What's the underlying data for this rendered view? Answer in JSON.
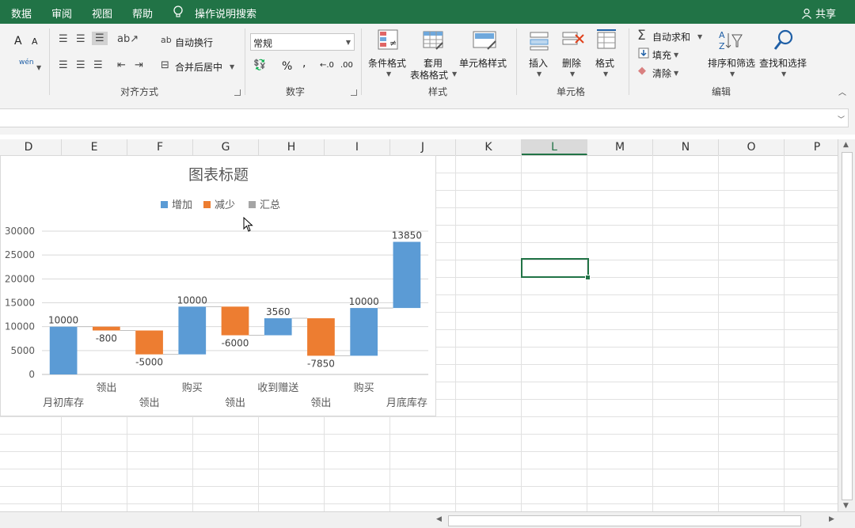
{
  "tabs": [
    "数据",
    "审阅",
    "视图",
    "帮助"
  ],
  "tell_me": "操作说明搜索",
  "share": "共享",
  "ribbon": {
    "font_grow": "A",
    "font_shrink": "A",
    "phonetic": "wén",
    "wrap_text": "自动换行",
    "merge_center": "合并后居中",
    "number_format": "常规",
    "percent": "%",
    "comma": ",",
    "inc_decimal": "←.0",
    "dec_decimal": ".00",
    "cond_format": "条件格式",
    "table_format_1": "套用",
    "table_format_2": "表格格式",
    "cell_styles": "单元格样式",
    "insert": "插入",
    "delete": "删除",
    "format": "格式",
    "autosum": "自动求和",
    "fill": "填充",
    "clear": "清除",
    "sort_filter": "排序和筛选",
    "find_select": "查找和选择",
    "groups": {
      "alignment": "对齐方式",
      "number": "数字",
      "styles": "样式",
      "cells": "单元格",
      "editing": "编辑"
    }
  },
  "columns": [
    "D",
    "E",
    "F",
    "G",
    "H",
    "I",
    "J",
    "K",
    "L",
    "M",
    "N",
    "O",
    "P"
  ],
  "selected_column": "L",
  "chart_data": {
    "type": "bar",
    "subtype": "waterfall",
    "title": "图表标题",
    "legend": [
      "增加",
      "减少",
      "汇总"
    ],
    "legend_position": "top",
    "colors": {
      "增加": "#5b9bd5",
      "减少": "#ed7d31",
      "汇总": "#a5a5a5"
    },
    "ylim": [
      0,
      30000
    ],
    "yticks": [
      0,
      5000,
      10000,
      15000,
      20000,
      25000,
      30000
    ],
    "grid": true,
    "categories": [
      "月初库存",
      "领出",
      "领出",
      "购买",
      "领出",
      "收到赠送",
      "领出",
      "购买",
      "月底库存"
    ],
    "values": [
      10000,
      -800,
      -5000,
      10000,
      -6000,
      3560,
      -7850,
      10000,
      13850
    ],
    "label_texts": [
      "10000",
      "-800",
      "-5000",
      "10000",
      "-6000",
      "3560",
      "-7850",
      "10000",
      "13850"
    ],
    "category_label_row": [
      1,
      0,
      1,
      0,
      1,
      0,
      1,
      0,
      1
    ]
  }
}
